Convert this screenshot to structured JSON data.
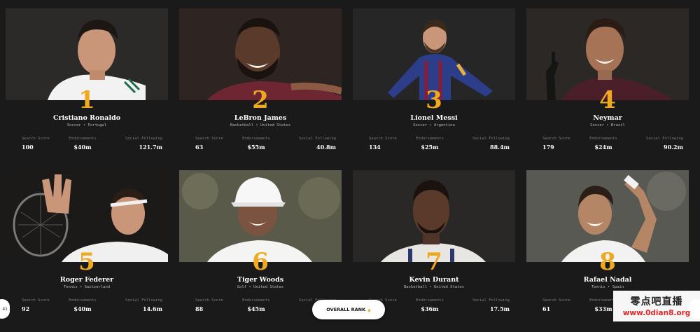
{
  "stat_labels": {
    "search": "Search Score",
    "endorsements": "Endorsements",
    "social": "Social Following"
  },
  "athletes": [
    {
      "rank": "1",
      "name": "Cristiano Ronaldo",
      "sport": "Soccer • Portugal",
      "search": "100",
      "endorsements": "$40m",
      "social": "121.7m"
    },
    {
      "rank": "2",
      "name": "LeBron James",
      "sport": "Basketball • United States",
      "search": "63",
      "endorsements": "$55m",
      "social": "40.8m"
    },
    {
      "rank": "3",
      "name": "Lionel Messi",
      "sport": "Soccer • Argentina",
      "search": "134",
      "endorsements": "$25m",
      "social": "88.4m"
    },
    {
      "rank": "4",
      "name": "Neymar",
      "sport": "Soccer • Brazil",
      "search": "179",
      "endorsements": "$24m",
      "social": "90.2m"
    },
    {
      "rank": "5",
      "name": "Roger Federer",
      "sport": "Tennis • Switzerland",
      "search": "92",
      "endorsements": "$40m",
      "social": "14.6m"
    },
    {
      "rank": "6",
      "name": "Tiger Woods",
      "sport": "Golf • United States",
      "search": "88",
      "endorsements": "$45m",
      "social": ""
    },
    {
      "rank": "7",
      "name": "Kevin Durant",
      "sport": "Basketball • United States",
      "search": "",
      "endorsements": "$36m",
      "social": "17.5m"
    },
    {
      "rank": "8",
      "name": "Rafael Nadal",
      "sport": "Tennis • Spain",
      "search": "61",
      "endorsements": "$33m",
      "social": ""
    }
  ],
  "overall_rank_button": "OVERALL RANK",
  "overall_rank_arrow": "▲",
  "left_edge_button": "41",
  "watermark": {
    "line1": "零点吧直播",
    "line2": "www.0dian8.org"
  },
  "colors": {
    "accent_rank": "#f0a91e",
    "background": "#1a1a1a",
    "jersey_real_madrid": "#f2f2f2",
    "jersey_cavs": "#6f2633",
    "jersey_barca": "#2c3d8a",
    "jersey_psg": "#4a1f2a",
    "jersey_wizards": "#e8e6e2",
    "photo_bg_warm": "#3a3835"
  }
}
